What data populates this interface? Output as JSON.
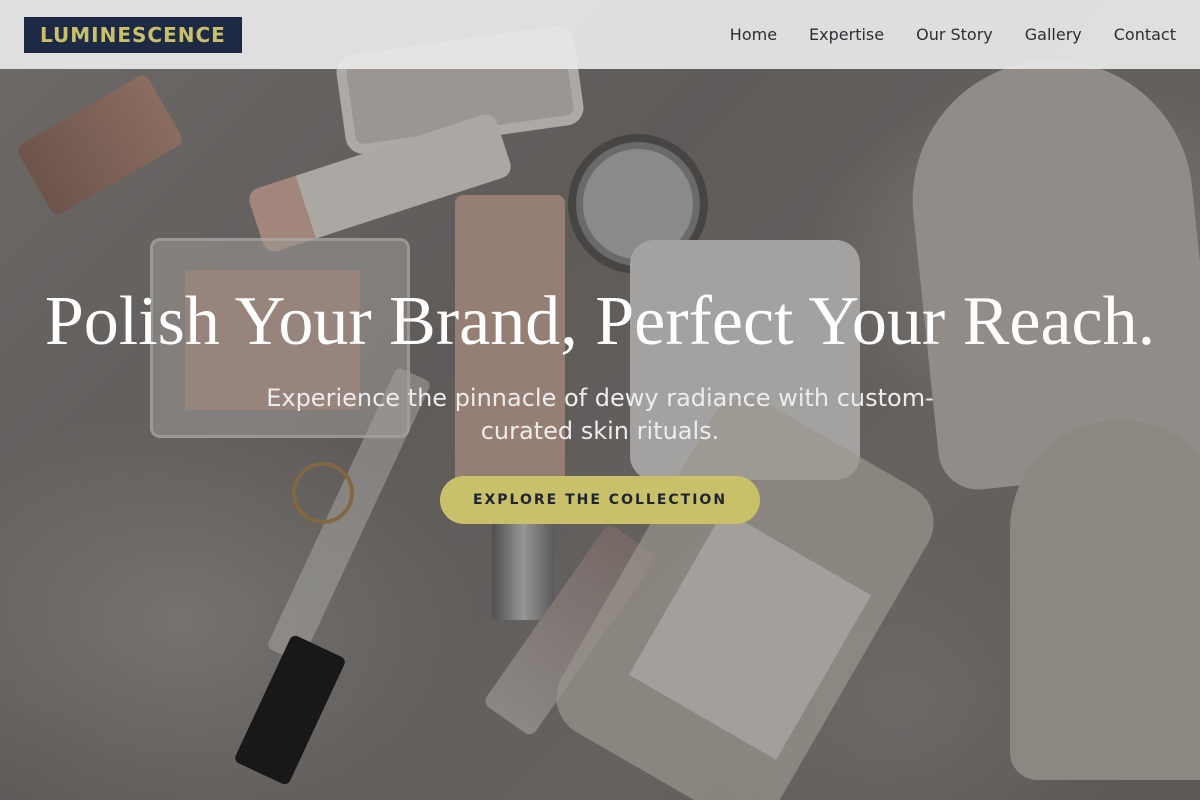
{
  "header": {
    "logo": "LUMINESCENCE",
    "nav": [
      "Home",
      "Expertise",
      "Our Story",
      "Gallery",
      "Contact"
    ]
  },
  "hero": {
    "title": "Polish Your Brand, Perfect Your Reach.",
    "subtitle": "Experience the pinnacle of dewy radiance with custom-curated skin rituals.",
    "cta_label": "EXPLORE THE COLLECTION"
  },
  "colors": {
    "logo_bg": "#1e2a44",
    "accent": "#c9c06a",
    "header_bg": "#e8e8e8"
  }
}
